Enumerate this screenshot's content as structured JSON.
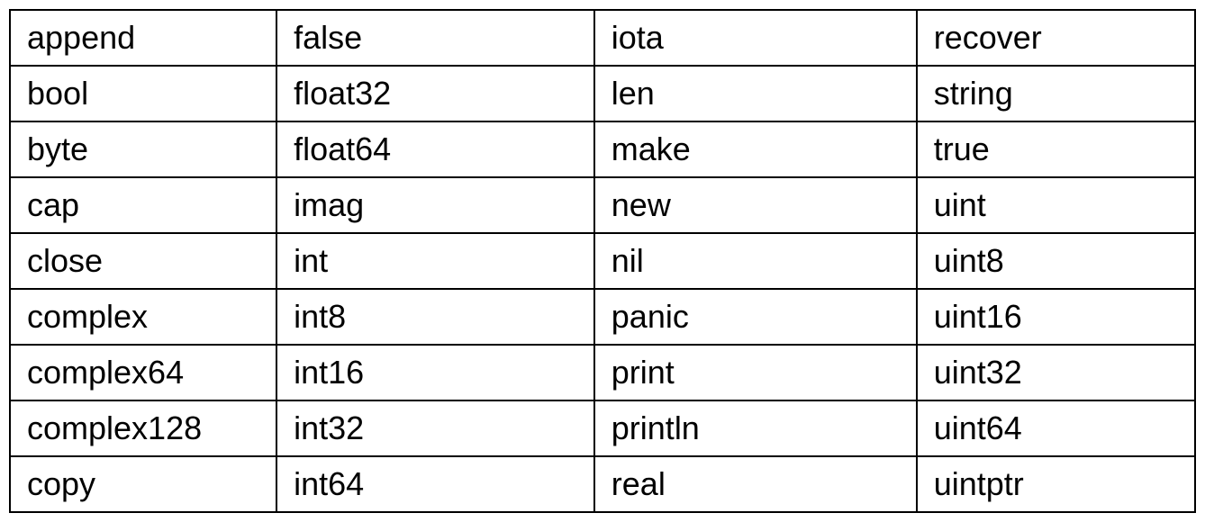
{
  "table": {
    "rows": [
      [
        "append",
        "false",
        "iota",
        "recover"
      ],
      [
        "bool",
        "float32",
        "len",
        "string"
      ],
      [
        "byte",
        "float64",
        "make",
        "true"
      ],
      [
        "cap",
        "imag",
        "new",
        "uint"
      ],
      [
        "close",
        "int",
        "nil",
        "uint8"
      ],
      [
        "complex",
        "int8",
        "panic",
        "uint16"
      ],
      [
        "complex64",
        "int16",
        "print",
        "uint32"
      ],
      [
        "complex128",
        "int32",
        "println",
        "uint64"
      ],
      [
        "copy",
        "int64",
        "real",
        "uintptr"
      ]
    ]
  }
}
